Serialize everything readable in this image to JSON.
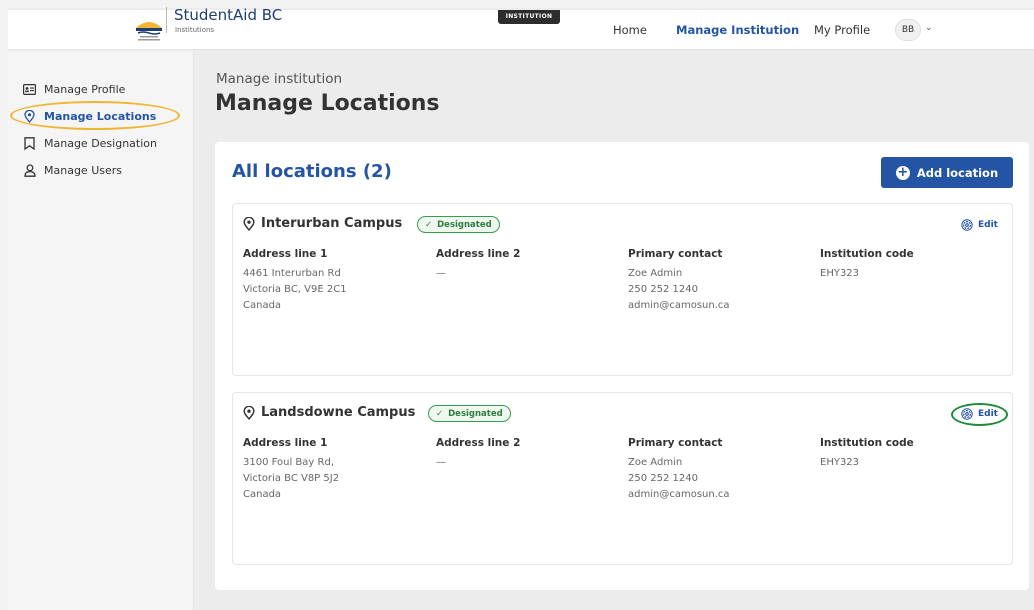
{
  "header": {
    "brand_title": "StudentAid BC",
    "brand_sub": "Institutions",
    "badge": "INSTITUTION",
    "nav": {
      "home": "Home",
      "manage": "Manage Institution",
      "profile": "My Profile"
    },
    "avatar_initials": "BB",
    "accent": "#2455a4"
  },
  "sidebar": {
    "items": [
      {
        "label": "Manage Profile",
        "icon": "id-card-icon"
      },
      {
        "label": "Manage Locations",
        "icon": "location-pin-icon",
        "active": true
      },
      {
        "label": "Manage Designation",
        "icon": "bookmark-icon"
      },
      {
        "label": "Manage Users",
        "icon": "user-icon"
      }
    ]
  },
  "main": {
    "breadcrumb": "Manage institution",
    "title": "Manage Locations",
    "list_title": "All locations (2)",
    "add_button": "Add location",
    "columns": {
      "addr1": "Address line 1",
      "addr2": "Address line 2",
      "contact": "Primary contact",
      "code": "Institution code"
    },
    "locations": [
      {
        "name": "Interurban Campus",
        "status": "Designated",
        "edit": "Edit",
        "addr1": [
          "4461 Interurban Rd",
          "Victoria BC, V9E 2C1",
          "Canada"
        ],
        "addr2": "—",
        "contact": [
          "Zoe Admin",
          "250 252 1240",
          "admin@camosun.ca"
        ],
        "code": "EHY323"
      },
      {
        "name": "Landsdowne Campus",
        "status": "Designated",
        "edit": "Edit",
        "addr1": [
          "3100 Foul Bay Rd,",
          "Victoria BC V8P 5J2",
          "Canada"
        ],
        "addr2": "—",
        "contact": [
          "Zoe Admin",
          "250 252 1240",
          "admin@camosun.ca"
        ],
        "code": "EHY323"
      }
    ]
  },
  "colors": {
    "highlight_yellow": "#f2b531",
    "highlight_green": "#1e8a3a",
    "status_green": "#3a9b4e"
  }
}
